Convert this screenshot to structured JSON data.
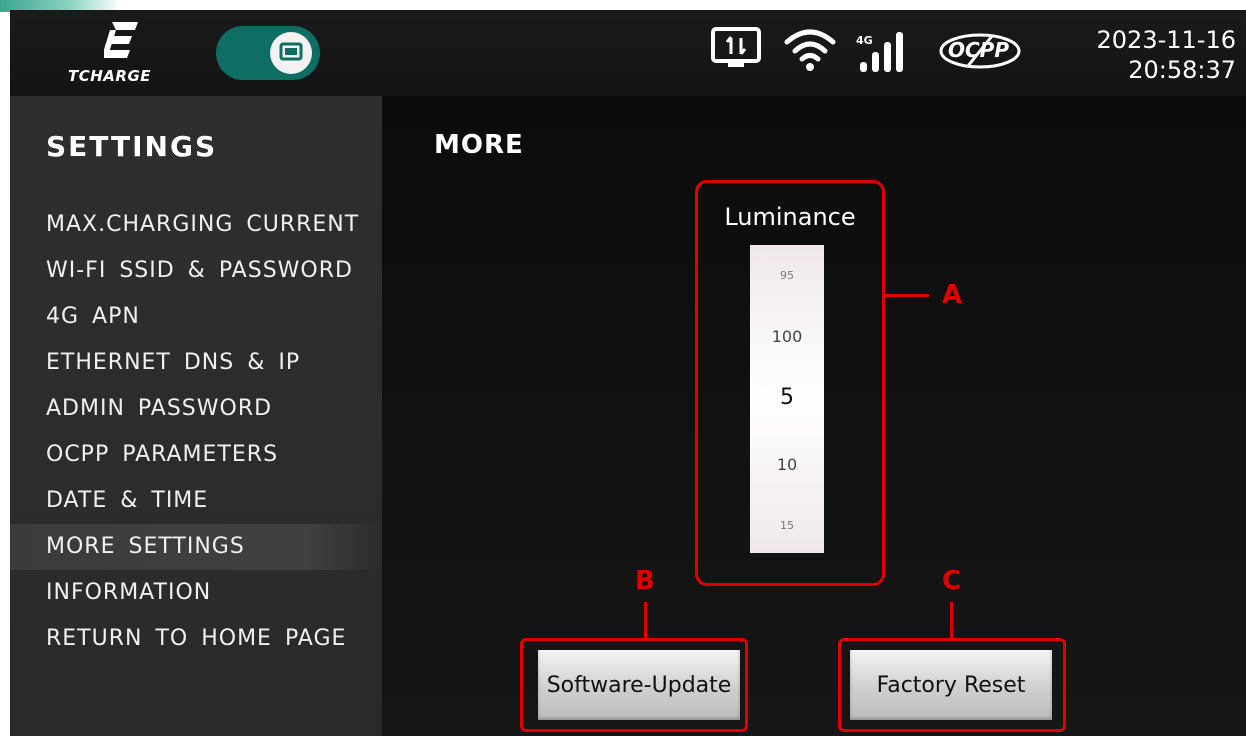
{
  "header": {
    "brand": "TCHARGE",
    "date": "2023-11-16",
    "time": "20:58:37",
    "network_badge": "4G",
    "status_icons": [
      "monitor-transfer-icon",
      "wifi-icon",
      "signal-4g-icon",
      "ocpp-disconnected-icon"
    ],
    "ocpp_label": "OCPP",
    "toggle_icon": "monitor-icon",
    "accent_color": "#0f6e63"
  },
  "sidebar": {
    "title": "SETTINGS",
    "items": [
      {
        "label": "MAX.CHARGING CURRENT"
      },
      {
        "label": "WI-FI SSID & PASSWORD"
      },
      {
        "label": "4G APN"
      },
      {
        "label": "ETHERNET DNS & IP"
      },
      {
        "label": "ADMIN PASSWORD"
      },
      {
        "label": "OCPP PARAMETERS"
      },
      {
        "label": "DATE & TIME"
      },
      {
        "label": "MORE SETTINGS",
        "active": true
      },
      {
        "label": "INFORMATION"
      },
      {
        "label": "RETURN TO HOME PAGE"
      }
    ]
  },
  "main": {
    "title": "MORE",
    "luminance": {
      "label": "Luminance",
      "wheel_values": [
        "95",
        "100",
        "5",
        "10",
        "15"
      ],
      "selected": "5"
    },
    "buttons": {
      "software_update": "Software-Update",
      "factory_reset": "Factory Reset"
    },
    "callouts": {
      "a": "A",
      "b": "B",
      "c": "C"
    },
    "highlight_color": "#e00000"
  }
}
